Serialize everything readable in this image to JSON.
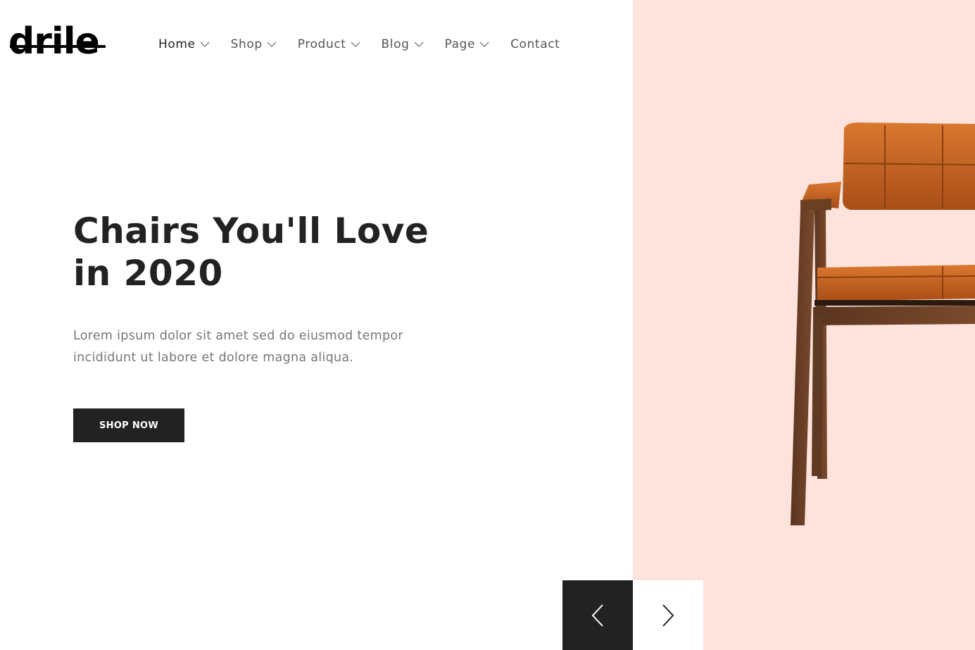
{
  "brand": {
    "logo_text": "drile"
  },
  "nav": {
    "items": [
      {
        "label": "Home",
        "has_dropdown": true,
        "active": true
      },
      {
        "label": "Shop",
        "has_dropdown": true
      },
      {
        "label": "Product",
        "has_dropdown": true
      },
      {
        "label": "Blog",
        "has_dropdown": true
      },
      {
        "label": "Page",
        "has_dropdown": true
      },
      {
        "label": "Contact",
        "has_dropdown": false
      }
    ]
  },
  "hero": {
    "title_line1": "Chairs You'll Love",
    "title_line2": "in 2020",
    "description_line1": "Lorem ipsum dolor sit amet sed do eiusmod tempor",
    "description_line2": "incididunt ut labore et dolore magna aliqua.",
    "cta_label": "SHOP NOW"
  },
  "slider": {
    "prev_icon": "chevron-left-icon",
    "next_icon": "chevron-right-icon"
  },
  "colors": {
    "panel_background": "#fde3dc",
    "text_dark": "#222222",
    "text_muted": "#777777",
    "button_dark": "#222222"
  }
}
